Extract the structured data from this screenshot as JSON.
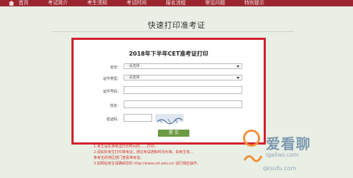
{
  "nav": {
    "items": [
      "首页",
      "考试简介",
      "考生须知",
      "考试时间",
      "报名流程",
      "常见问题",
      "特别提示"
    ]
  },
  "page_title": "快速打印准考证",
  "form": {
    "heading": "2018年下半年CET准考证打印",
    "province_label": "省份：",
    "province_value": "- 请选择 -",
    "cert_type_label": "证件类型：",
    "cert_type_value": "- 请选择 -",
    "cert_no_label": "证件号码：",
    "cert_no_value": "",
    "name_label": "姓名：",
    "name_value": "",
    "captcha_label": "验证码：",
    "captcha_value": "",
    "submit_label": "提 交"
  },
  "notes": [
    "1.考生请在准考证打印时间内……打印。",
    "2.请如实考生打印准考证。通过考试通知时间为准。如考生有…",
    "  条考生的地区部门查看准考证。",
    "3.如网站考生请确保您的 http://www.cet.edu.cn/ 进行相应操作。"
  ],
  "watermark": {
    "brand": "爱看聊",
    "url1": "igaliao.com",
    "url2": "qksufu.com"
  },
  "colors": {
    "nav_bg": "#9b2630",
    "form_border": "#d2212d",
    "submit_bg": "#6d9a45",
    "page_bg": "#e9efe5"
  }
}
